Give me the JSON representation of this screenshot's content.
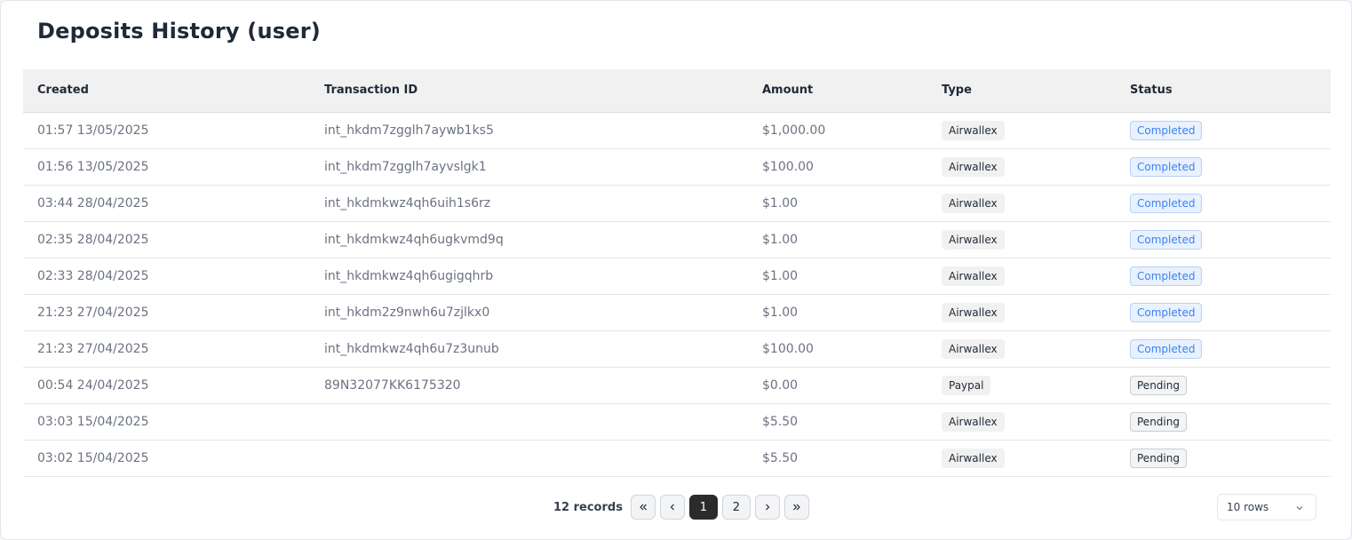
{
  "page": {
    "title": "Deposits History (user)"
  },
  "table": {
    "headers": [
      "Created",
      "Transaction ID",
      "Amount",
      "Type",
      "Status"
    ],
    "rows": [
      {
        "created": "01:57 13/05/2025",
        "txid": "int_hkdm7zgglh7aywb1ks5",
        "amount": "$1,000.00",
        "type": "Airwallex",
        "status": "Completed"
      },
      {
        "created": "01:56 13/05/2025",
        "txid": "int_hkdm7zgglh7ayvslgk1",
        "amount": "$100.00",
        "type": "Airwallex",
        "status": "Completed"
      },
      {
        "created": "03:44 28/04/2025",
        "txid": "int_hkdmkwz4qh6uih1s6rz",
        "amount": "$1.00",
        "type": "Airwallex",
        "status": "Completed"
      },
      {
        "created": "02:35 28/04/2025",
        "txid": "int_hkdmkwz4qh6ugkvmd9q",
        "amount": "$1.00",
        "type": "Airwallex",
        "status": "Completed"
      },
      {
        "created": "02:33 28/04/2025",
        "txid": "int_hkdmkwz4qh6ugigqhrb",
        "amount": "$1.00",
        "type": "Airwallex",
        "status": "Completed"
      },
      {
        "created": "21:23 27/04/2025",
        "txid": "int_hkdm2z9nwh6u7zjlkx0",
        "amount": "$1.00",
        "type": "Airwallex",
        "status": "Completed"
      },
      {
        "created": "21:23 27/04/2025",
        "txid": "int_hkdmkwz4qh6u7z3unub",
        "amount": "$100.00",
        "type": "Airwallex",
        "status": "Completed"
      },
      {
        "created": "00:54 24/04/2025",
        "txid": "89N32077KK6175320",
        "amount": "$0.00",
        "type": "Paypal",
        "status": "Pending"
      },
      {
        "created": "03:03 15/04/2025",
        "txid": "",
        "amount": "$5.50",
        "type": "Airwallex",
        "status": "Pending"
      },
      {
        "created": "03:02 15/04/2025",
        "txid": "",
        "amount": "$5.50",
        "type": "Airwallex",
        "status": "Pending"
      }
    ]
  },
  "pagination": {
    "records_label": "12 records",
    "pages": [
      "1",
      "2"
    ],
    "current_page": "1",
    "rows_per_page": "10 rows",
    "icons": {
      "first": "double-chevron-left-icon",
      "prev": "chevron-left-icon",
      "next": "chevron-right-icon",
      "last": "double-chevron-right-icon",
      "select": "chevron-down-icon"
    }
  },
  "colors": {
    "completed_text": "#3b82f6",
    "completed_bg": "#e8f1fd",
    "active_page_bg": "#2b2b2b"
  }
}
